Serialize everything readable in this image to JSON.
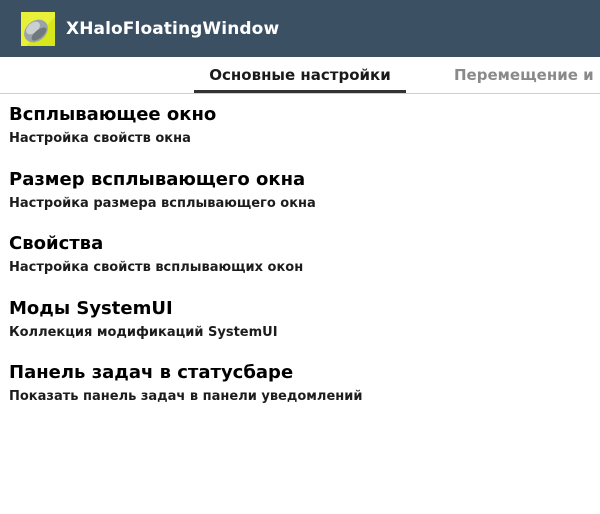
{
  "action_bar": {
    "title": "XHaloFloatingWindow",
    "icon": "app-logo-icon"
  },
  "tabs": [
    {
      "label": "Основные настройки",
      "selected": true
    },
    {
      "label": "Перемещение и и",
      "selected": false
    }
  ],
  "preferences": [
    {
      "title": "Всплывающее окно",
      "summary": "Настройка свойств окна"
    },
    {
      "title": "Размер всплывающего окна",
      "summary": "Настройка размера всплывающего окна"
    },
    {
      "title": "Свойства",
      "summary": "Настройка свойств всплывающих окон"
    },
    {
      "title": "Моды SystemUI",
      "summary": "Коллекция модификаций SystemUI"
    },
    {
      "title": "Панель задач в статусбаре",
      "summary": "Показать панель задач в панели уведомлений"
    }
  ],
  "colors": {
    "action_bar": "#3c5064",
    "icon_yellow": "#d8e61c",
    "tab_indicator": "#333333"
  }
}
